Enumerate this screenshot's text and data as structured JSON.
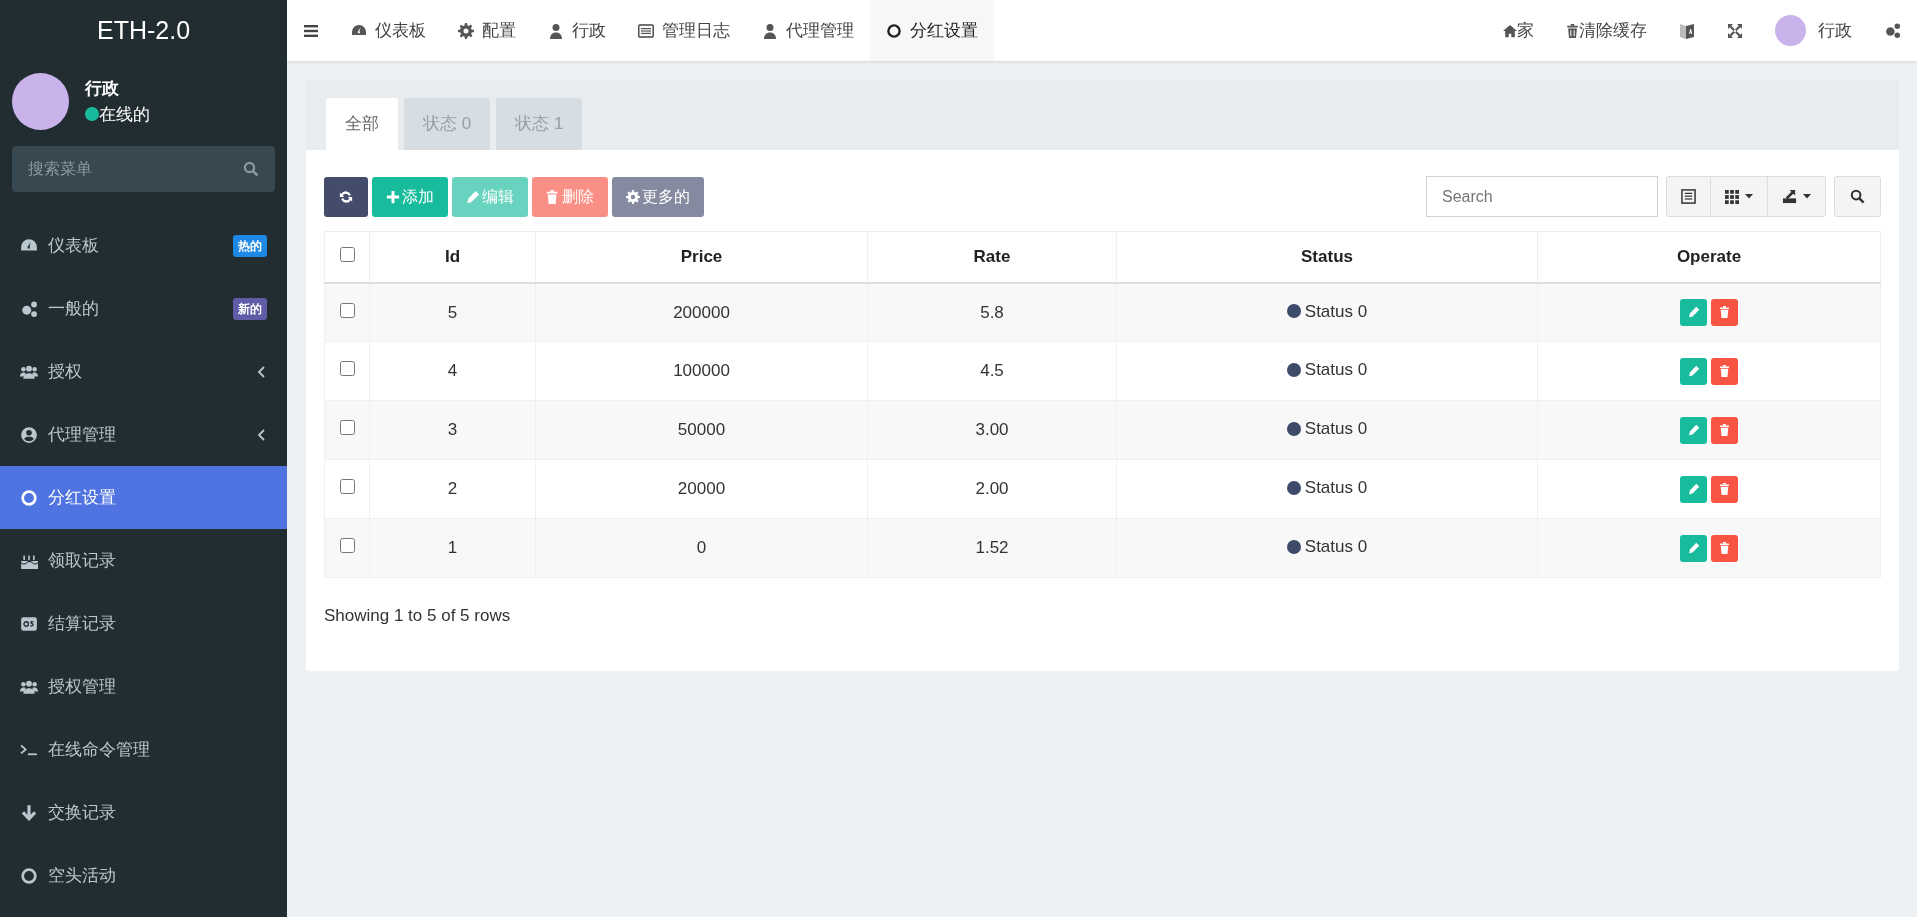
{
  "sidebar": {
    "logo": "ETH-2.0",
    "user": {
      "name": "行政",
      "status": "在线的"
    },
    "search": {
      "placeholder": "搜索菜单"
    },
    "items": [
      {
        "label": "仪表板",
        "selected": false,
        "collapsible": false,
        "badge": {
          "text": "热的",
          "color": "#1e88e5"
        }
      },
      {
        "label": "一般的",
        "selected": false,
        "collapsible": false,
        "badge": {
          "text": "新的",
          "color": "#605ca8"
        }
      },
      {
        "label": "授权",
        "selected": false,
        "collapsible": true
      },
      {
        "label": "代理管理",
        "selected": false,
        "collapsible": true
      },
      {
        "label": "分红设置",
        "selected": true,
        "collapsible": false
      },
      {
        "label": "领取记录",
        "selected": false,
        "collapsible": false
      },
      {
        "label": "结算记录",
        "selected": false,
        "collapsible": false
      },
      {
        "label": "授权管理",
        "selected": false,
        "collapsible": false
      },
      {
        "label": "在线命令管理",
        "selected": false,
        "collapsible": false
      },
      {
        "label": "交换记录",
        "selected": false,
        "collapsible": false
      },
      {
        "label": "空头活动",
        "selected": false,
        "collapsible": false
      }
    ]
  },
  "topbar": {
    "tabs": [
      {
        "label": "仪表板",
        "selected": false
      },
      {
        "label": "配置",
        "selected": false
      },
      {
        "label": "行政",
        "selected": false
      },
      {
        "label": "管理日志",
        "selected": false
      },
      {
        "label": "代理管理",
        "selected": false
      },
      {
        "label": "分红设置",
        "selected": true
      }
    ],
    "right": {
      "home": "家",
      "clear_cache": "清除缓存",
      "user": "行政"
    }
  },
  "panel": {
    "tabs": [
      {
        "label": "全部",
        "selected": true
      },
      {
        "label": "状态 0",
        "selected": false
      },
      {
        "label": "状态 1",
        "selected": false
      }
    ],
    "toolbar": [
      {
        "kind": "refresh",
        "disabled": false
      },
      {
        "kind": "add",
        "label": "添加",
        "disabled": false
      },
      {
        "kind": "edit",
        "label": "编辑",
        "disabled": true
      },
      {
        "kind": "delete",
        "label": "删除",
        "disabled": true
      },
      {
        "kind": "more",
        "label": "更多的",
        "disabled": false
      }
    ],
    "search": {
      "placeholder": "Search"
    },
    "table": {
      "select_all_checked": false,
      "columns": [
        "Id",
        "Price",
        "Rate",
        "Status",
        "Operate"
      ],
      "rows": [
        {
          "checked": false,
          "id": "5",
          "price": "200000",
          "rate": "5.8",
          "status": "Status 0"
        },
        {
          "checked": false,
          "id": "4",
          "price": "100000",
          "rate": "4.5",
          "status": "Status 0"
        },
        {
          "checked": false,
          "id": "3",
          "price": "50000",
          "rate": "3.00",
          "status": "Status 0"
        },
        {
          "checked": false,
          "id": "2",
          "price": "20000",
          "rate": "2.00",
          "status": "Status 0"
        },
        {
          "checked": false,
          "id": "1",
          "price": "0",
          "rate": "1.52",
          "status": "Status 0"
        }
      ]
    },
    "pagination_info": "Showing 1 to 5 of 5 rows"
  }
}
